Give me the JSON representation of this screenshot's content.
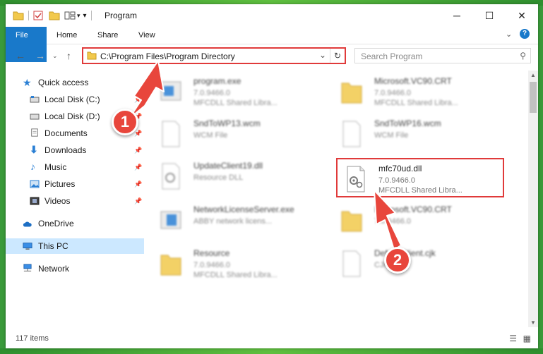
{
  "window": {
    "title": "Program"
  },
  "ribbon": {
    "tabs": [
      "File",
      "Home",
      "Share",
      "View"
    ]
  },
  "address": {
    "path": "C:\\Program Files\\Program Directory"
  },
  "search": {
    "placeholder": "Search Program"
  },
  "sidebar": {
    "items": [
      {
        "label": "Quick access",
        "icon": "star-icon"
      },
      {
        "label": "Local Disk (C:)",
        "icon": "drive-icon"
      },
      {
        "label": "Local Disk (D:)",
        "icon": "drive-icon"
      },
      {
        "label": "Documents",
        "icon": "documents-icon"
      },
      {
        "label": "Downloads",
        "icon": "download-icon"
      },
      {
        "label": "Music",
        "icon": "music-icon"
      },
      {
        "label": "Pictures",
        "icon": "pictures-icon"
      },
      {
        "label": "Videos",
        "icon": "videos-icon"
      },
      {
        "label": "OneDrive",
        "icon": "cloud-icon"
      },
      {
        "label": "This PC",
        "icon": "computer-icon"
      },
      {
        "label": "Network",
        "icon": "network-icon"
      }
    ]
  },
  "files": [
    {
      "name": "program.exe",
      "line2": "7.0.9466.0",
      "line3": "MFCDLL Shared Libra..."
    },
    {
      "name": "Microsoft.VC90.CRT",
      "line2": "7.0.9466.0",
      "line3": "MFCDLL Shared Libra..."
    },
    {
      "name": "SndToWP13.wcm",
      "line2": "WCM File",
      "line3": ""
    },
    {
      "name": "SndToWP16.wcm",
      "line2": "WCM File",
      "line3": ""
    },
    {
      "name": "UpdateClient19.dll",
      "line2": "Resource DLL",
      "line3": ""
    },
    {
      "name": "mfc70ud.dll",
      "line2": "7.0.9466.0",
      "line3": "MFCDLL Shared Libra..."
    },
    {
      "name": "NetworkLicenseServer.exe",
      "line2": "ABBY network licens...",
      "line3": ""
    },
    {
      "name": "Microsoft.VC90.CRT",
      "line2": "7.0.9466.0",
      "line3": ""
    },
    {
      "name": "Resource",
      "line2": "7.0.9466.0",
      "line3": "MFCDLL Shared Libra..."
    },
    {
      "name": "DefaultClient.cjk",
      "line2": "CJK File",
      "line3": ""
    }
  ],
  "status": {
    "count": "117 items"
  },
  "annotations": {
    "step1": "1",
    "step2": "2",
    "color": "#e8463c"
  }
}
